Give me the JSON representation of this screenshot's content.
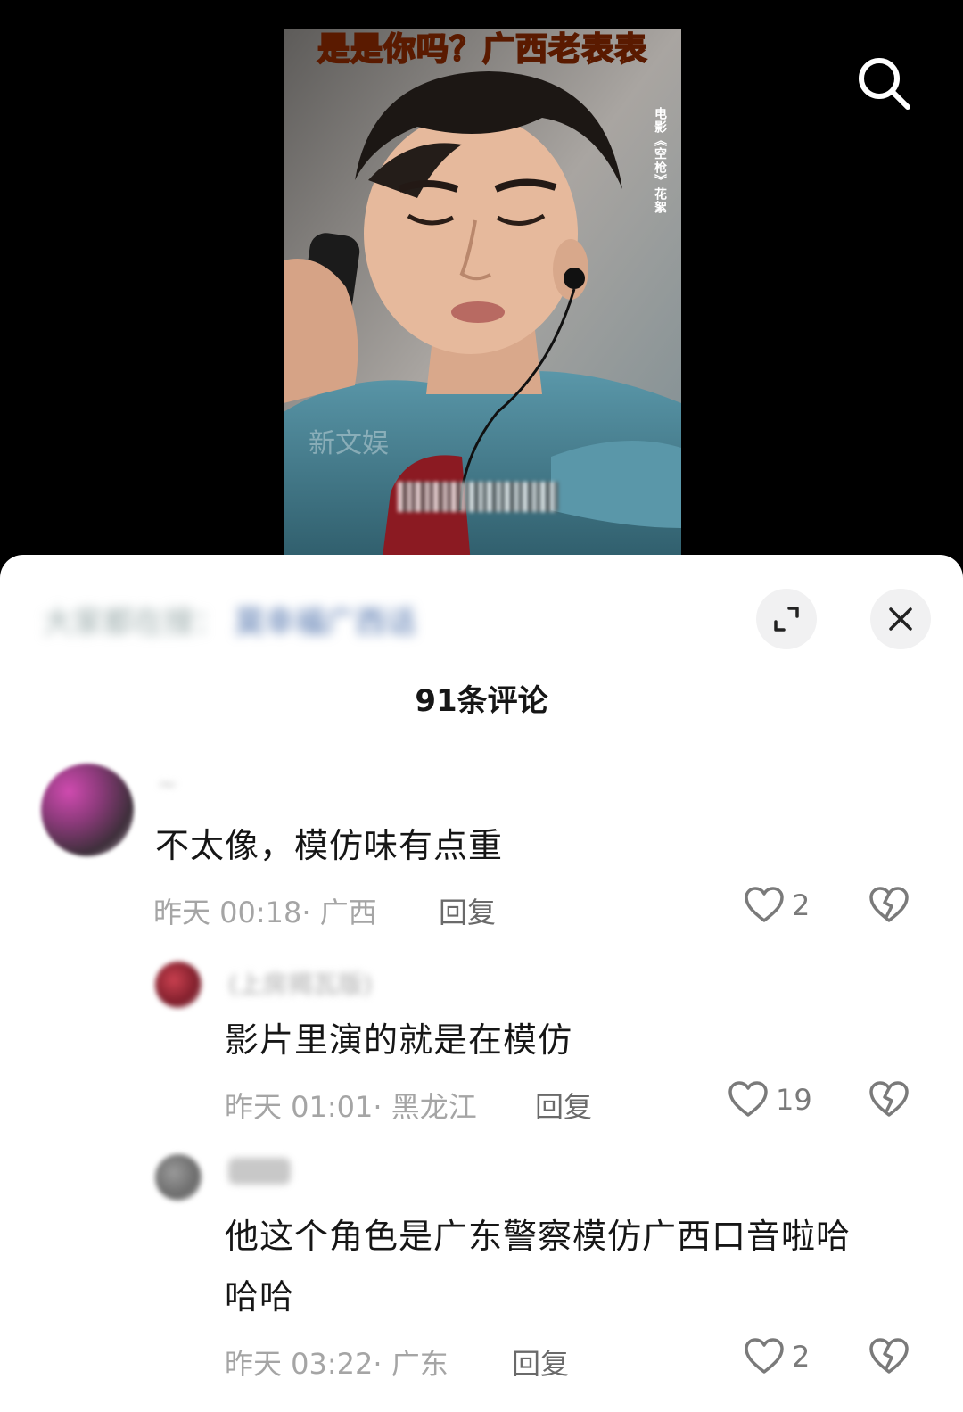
{
  "video": {
    "title_overlay": "是是你吗？广西老表表",
    "side_caption": "电影《空枪》花絮",
    "watermark": "新文娱"
  },
  "sheet": {
    "header_blurred_text": "大家都在搜：",
    "header_blurred_link": "莫幸福广西话",
    "comment_count": "91条评论"
  },
  "comments": [
    {
      "username": "~",
      "text": "不太像，模仿味有点重",
      "time_location": "昨天 00:18· 广西",
      "reply_label": "回复",
      "likes": "2"
    },
    {
      "username": "(上房揭瓦版)",
      "text": "影片里演的就是在模仿",
      "time_location": "昨天 01:01· 黑龙江",
      "reply_label": "回复",
      "likes": "19"
    },
    {
      "username": "",
      "text_line1": "他这个角色是广东警察模仿广西口音啦哈",
      "text_line2": "哈哈",
      "time_location": "昨天 03:22· 广东",
      "reply_label": "回复",
      "likes": "2"
    }
  ],
  "icons": {
    "search": "search-icon",
    "expand": "expand-icon",
    "close": "close-icon",
    "like": "heart-icon",
    "dislike": "broken-heart-icon"
  },
  "colors": {
    "sheet_bg": "#ffffff",
    "meta_gray": "#a5a5a5",
    "title_orange": "#ff8a2a"
  }
}
